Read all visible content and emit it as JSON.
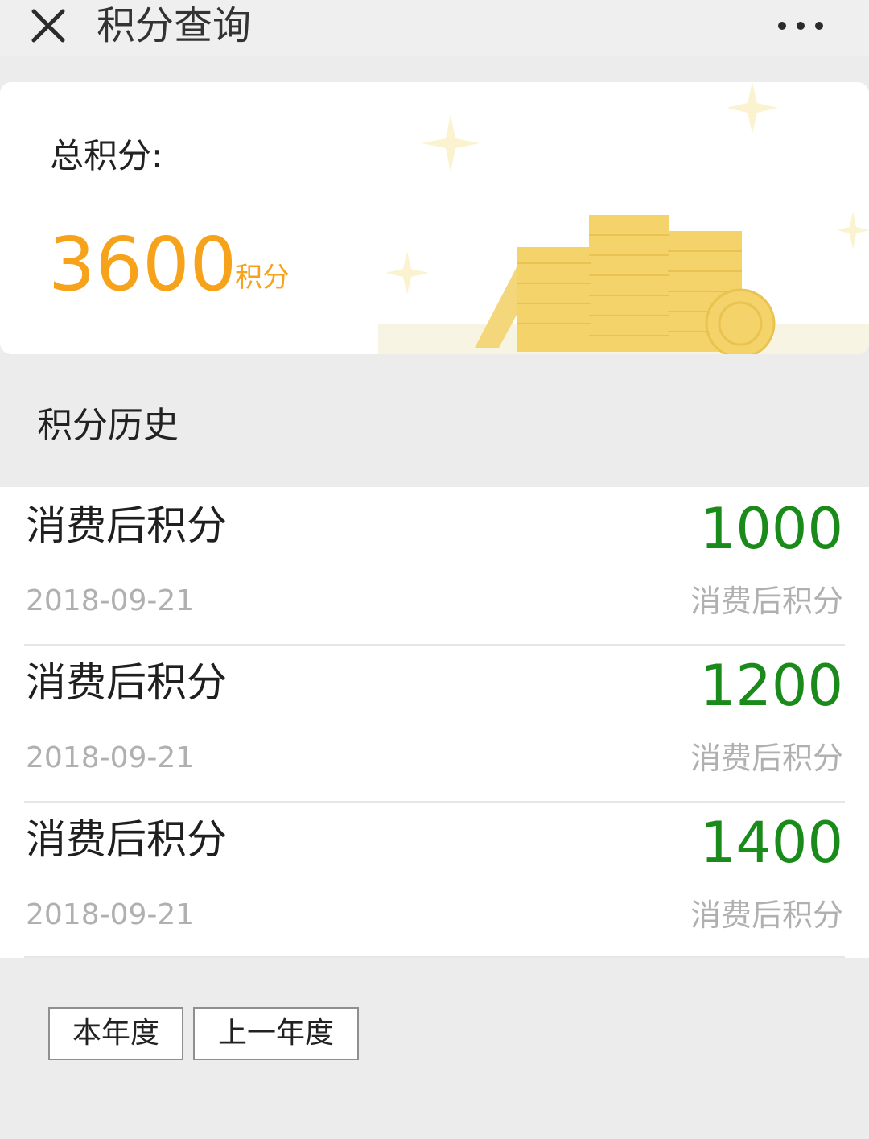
{
  "header": {
    "title": "积分查询",
    "close_icon": "close-icon",
    "more_icon": "more-dots-icon"
  },
  "summary": {
    "label": "总积分:",
    "value": "3600",
    "unit": "积分",
    "accent_color": "#f7a21b",
    "decoration_icon": "coin-stack-illustration"
  },
  "history": {
    "title": "积分历史",
    "amount_color": "#1a8a1a",
    "items": [
      {
        "title": "消费后积分",
        "amount": "1000",
        "date": "2018-09-21",
        "note": "消费后积分"
      },
      {
        "title": "消费后积分",
        "amount": "1200",
        "date": "2018-09-21",
        "note": "消费后积分"
      },
      {
        "title": "消费后积分",
        "amount": "1400",
        "date": "2018-09-21",
        "note": "消费后积分"
      }
    ]
  },
  "filters": {
    "this_year": "本年度",
    "last_year": "上一年度"
  }
}
